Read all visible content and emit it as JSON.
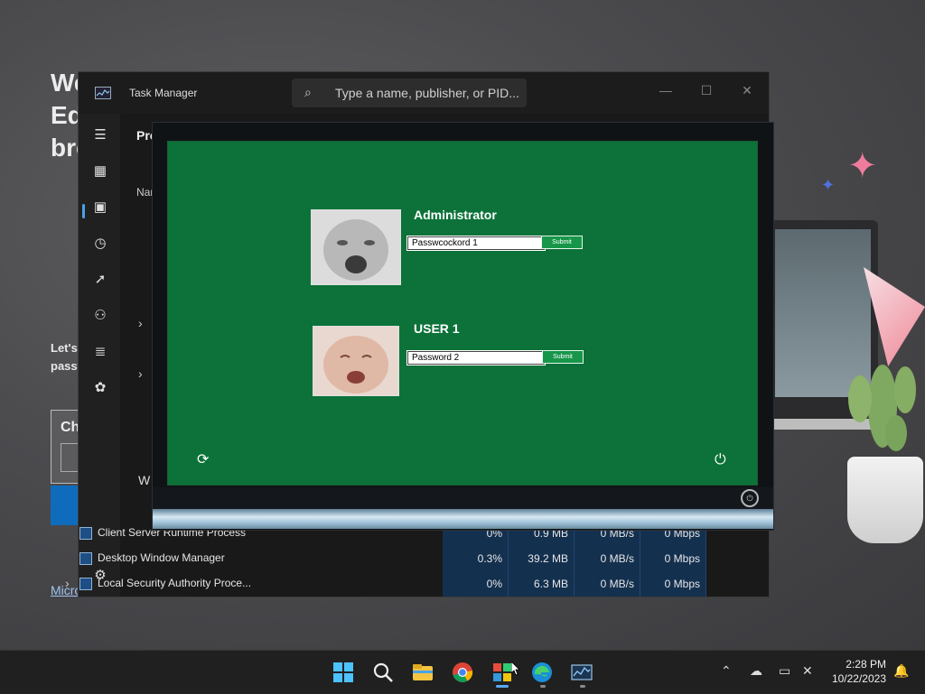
{
  "background": {
    "heading_lines": [
      "We",
      "Ed",
      "bro"
    ],
    "text_lines": [
      "Let's",
      "passw"
    ],
    "card_label": "Ch",
    "section_label": "W",
    "link_text": "Micro"
  },
  "taskmgr": {
    "title": "Task Manager",
    "search_placeholder": "Type a name, publisher, or PID...",
    "tab_heading": "Pro",
    "column_name": "Nan",
    "processes": [
      {
        "name": "Client Server Runtime Process",
        "cpu": "0%",
        "memory": "0.9 MB",
        "disk": "0 MB/s",
        "network": "0 Mbps",
        "expandable": false
      },
      {
        "name": "Desktop Window Manager",
        "cpu": "0.3%",
        "memory": "39.2 MB",
        "disk": "0 MB/s",
        "network": "0 Mbps",
        "expandable": false
      },
      {
        "name": "Local Security Authority Proce...",
        "cpu": "0%",
        "memory": "6.3 MB",
        "disk": "0 MB/s",
        "network": "0 Mbps",
        "expandable": true
      }
    ]
  },
  "logon": {
    "users": [
      {
        "name": "Administrator",
        "password_value": "Passwcockord 1",
        "submit_label": "Submit",
        "avatar": "baby-yelling-photo"
      },
      {
        "name": "USER 1",
        "password_value": "Password 2",
        "submit_label": "Submit",
        "avatar": "baby-crying-photo"
      }
    ],
    "panel_color": "#0c7239"
  },
  "taskbar": {
    "time": "2:28 PM",
    "date": "10/22/2023",
    "accent": "#5aa9f0"
  }
}
